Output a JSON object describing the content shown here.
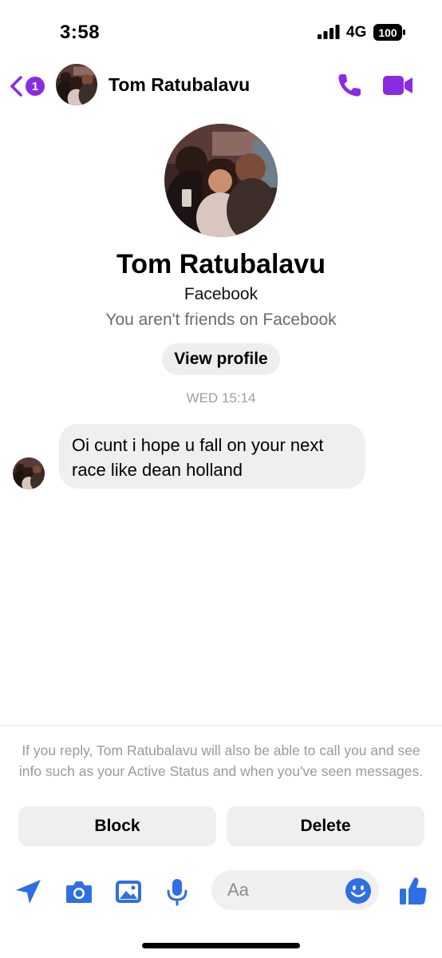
{
  "status_bar": {
    "time": "3:58",
    "network": "4G",
    "battery": "100"
  },
  "header": {
    "back_badge": "1",
    "contact_name": "Tom Ratubalavu"
  },
  "profile": {
    "name": "Tom Ratubalavu",
    "platform": "Facebook",
    "friend_status": "You aren't friends on Facebook",
    "view_profile_label": "View profile"
  },
  "conversation": {
    "timestamp": "WED 15:14",
    "messages": [
      {
        "text": "Oi cunt i hope u fall on your next race like dean holland"
      }
    ]
  },
  "request": {
    "notice": "If you reply, Tom Ratubalavu will also be able to call you and see info such as your Active Status and when you've seen messages.",
    "block_label": "Block",
    "delete_label": "Delete"
  },
  "composer": {
    "placeholder": "Aa",
    "icons": [
      "location-arrow-icon",
      "camera-icon",
      "photo-icon",
      "microphone-icon",
      "emoji-icon",
      "thumbs-up-icon"
    ]
  },
  "colors": {
    "accent_purple": "#8a2be2",
    "composer_blue": "#2f6fe4",
    "bubble_gray": "#efefef"
  }
}
